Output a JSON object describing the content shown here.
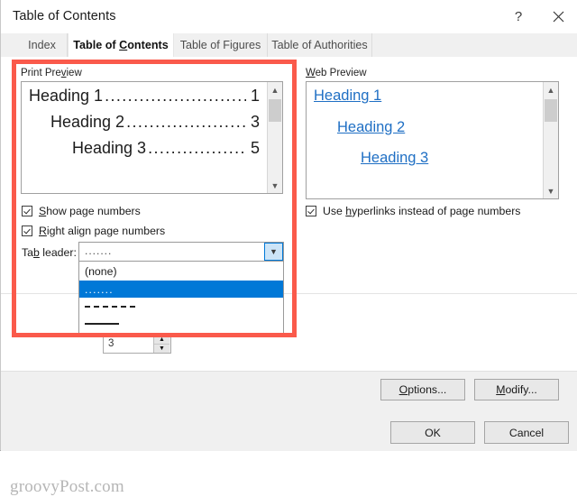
{
  "window": {
    "title": "Table of Contents",
    "help_label": "?",
    "close_label": "✕"
  },
  "tabs": [
    {
      "id": "index",
      "label": "Index",
      "accel": "",
      "active": false
    },
    {
      "id": "toc",
      "label": "Table of Contents",
      "accel": "C",
      "active": true
    },
    {
      "id": "figures",
      "label": "Table of Figures",
      "accel": "",
      "active": false
    },
    {
      "id": "authorities",
      "label": "Table of Authorities",
      "accel": "",
      "active": false
    }
  ],
  "print_preview": {
    "group_label_pre": "Print Pre",
    "group_label_accel": "v",
    "group_label_post": "iew",
    "lines": [
      {
        "heading": "Heading 1",
        "leader": "...................................",
        "page": "1"
      },
      {
        "heading": "Heading 2",
        "leader": "..............................",
        "page": "3"
      },
      {
        "heading": "Heading 3",
        "leader": "........................",
        "page": "5"
      }
    ]
  },
  "web_preview": {
    "group_label_accel": "W",
    "group_label_post": "eb Preview",
    "lines": [
      "Heading 1",
      "Heading 2",
      "Heading 3"
    ]
  },
  "options": {
    "show_page_numbers": {
      "accel": "S",
      "label_post": "how page numbers",
      "checked": true
    },
    "right_align_page_numbers": {
      "accel": "R",
      "label_post": "ight align page numbers",
      "checked": true
    },
    "use_hyperlinks": {
      "label_pre": "Use ",
      "accel": "h",
      "label_post": "yperlinks instead of page numbers",
      "checked": true
    }
  },
  "tab_leader": {
    "label_pre": "Ta",
    "label_accel": "b",
    "label_post": " leader:",
    "value": ".......",
    "arrow_icon": "chevron-down-icon",
    "open": true,
    "items": [
      {
        "id": "none",
        "label": "(none)",
        "kind": "text",
        "selected": false
      },
      {
        "id": "dots",
        "label": ".......",
        "kind": "dots",
        "selected": true
      },
      {
        "id": "dashes",
        "label": "-------",
        "kind": "dashes",
        "selected": false
      },
      {
        "id": "solid",
        "label": "—",
        "kind": "solid",
        "selected": false
      }
    ]
  },
  "show_levels": {
    "value": "3",
    "up_icon": "▲",
    "down_icon": "▼"
  },
  "buttons": {
    "options": {
      "accel": "O",
      "label_post": "ptions..."
    },
    "modify": {
      "accel": "M",
      "label_post": "odify..."
    },
    "ok": "OK",
    "cancel": "Cancel"
  },
  "annotation": {
    "highlight_color": "#fa5a4b"
  },
  "watermark": "groovyPost.com"
}
